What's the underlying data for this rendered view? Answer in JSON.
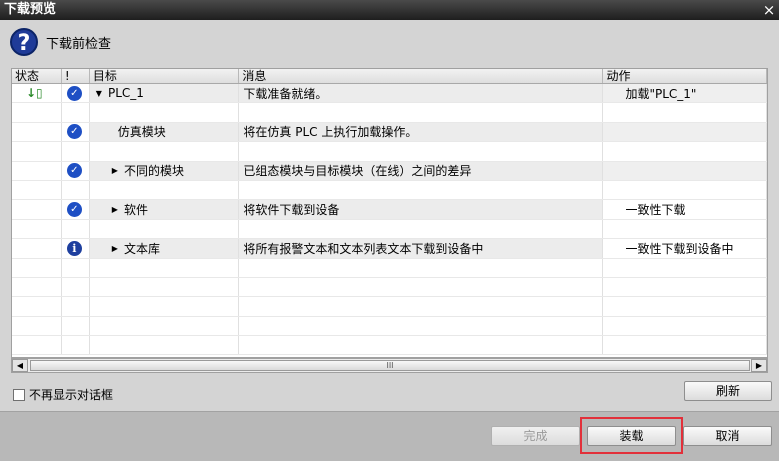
{
  "window": {
    "title": "下载预览",
    "close_label": "×"
  },
  "header": {
    "label": "下载前检查"
  },
  "table": {
    "columns": [
      "状态",
      "!",
      "目标",
      "消息",
      "动作"
    ],
    "rows": [
      {
        "status": "↓▯",
        "icon": "check",
        "expand": "▼",
        "target": "PLC_1",
        "message": "下载准备就绪。",
        "action": "加载\"PLC_1\"",
        "action_white": false,
        "level": 0
      },
      {
        "status": "",
        "icon": "check",
        "expand": "",
        "target": "仿真模块",
        "message": "将在仿真 PLC 上执行加载操作。",
        "action": "",
        "action_white": false,
        "level": 1
      },
      {
        "status": "",
        "icon": "check",
        "expand": "▶",
        "target": "不同的模块",
        "message": "已组态模块与目标模块（在线）之间的差异",
        "action": "",
        "action_white": false,
        "level": 1
      },
      {
        "status": "",
        "icon": "check",
        "expand": "▶",
        "target": "软件",
        "message": "将软件下载到设备",
        "action": "一致性下载",
        "action_white": true,
        "level": 1
      },
      {
        "status": "",
        "icon": "info",
        "expand": "▶",
        "target": "文本库",
        "message": "将所有报警文本和文本列表文本下载到设备中",
        "action": "一致性下载到设备中",
        "action_white": true,
        "level": 1
      }
    ]
  },
  "scroll": {
    "thumb_label": "III"
  },
  "options": {
    "no_show_label": "不再显示对话框"
  },
  "buttons": {
    "refresh": "刷新",
    "finish": "完成",
    "load": "装载",
    "cancel": "取消"
  },
  "colors": {
    "highlight": "#e2303a",
    "check_blue": "#1e4fc4"
  }
}
